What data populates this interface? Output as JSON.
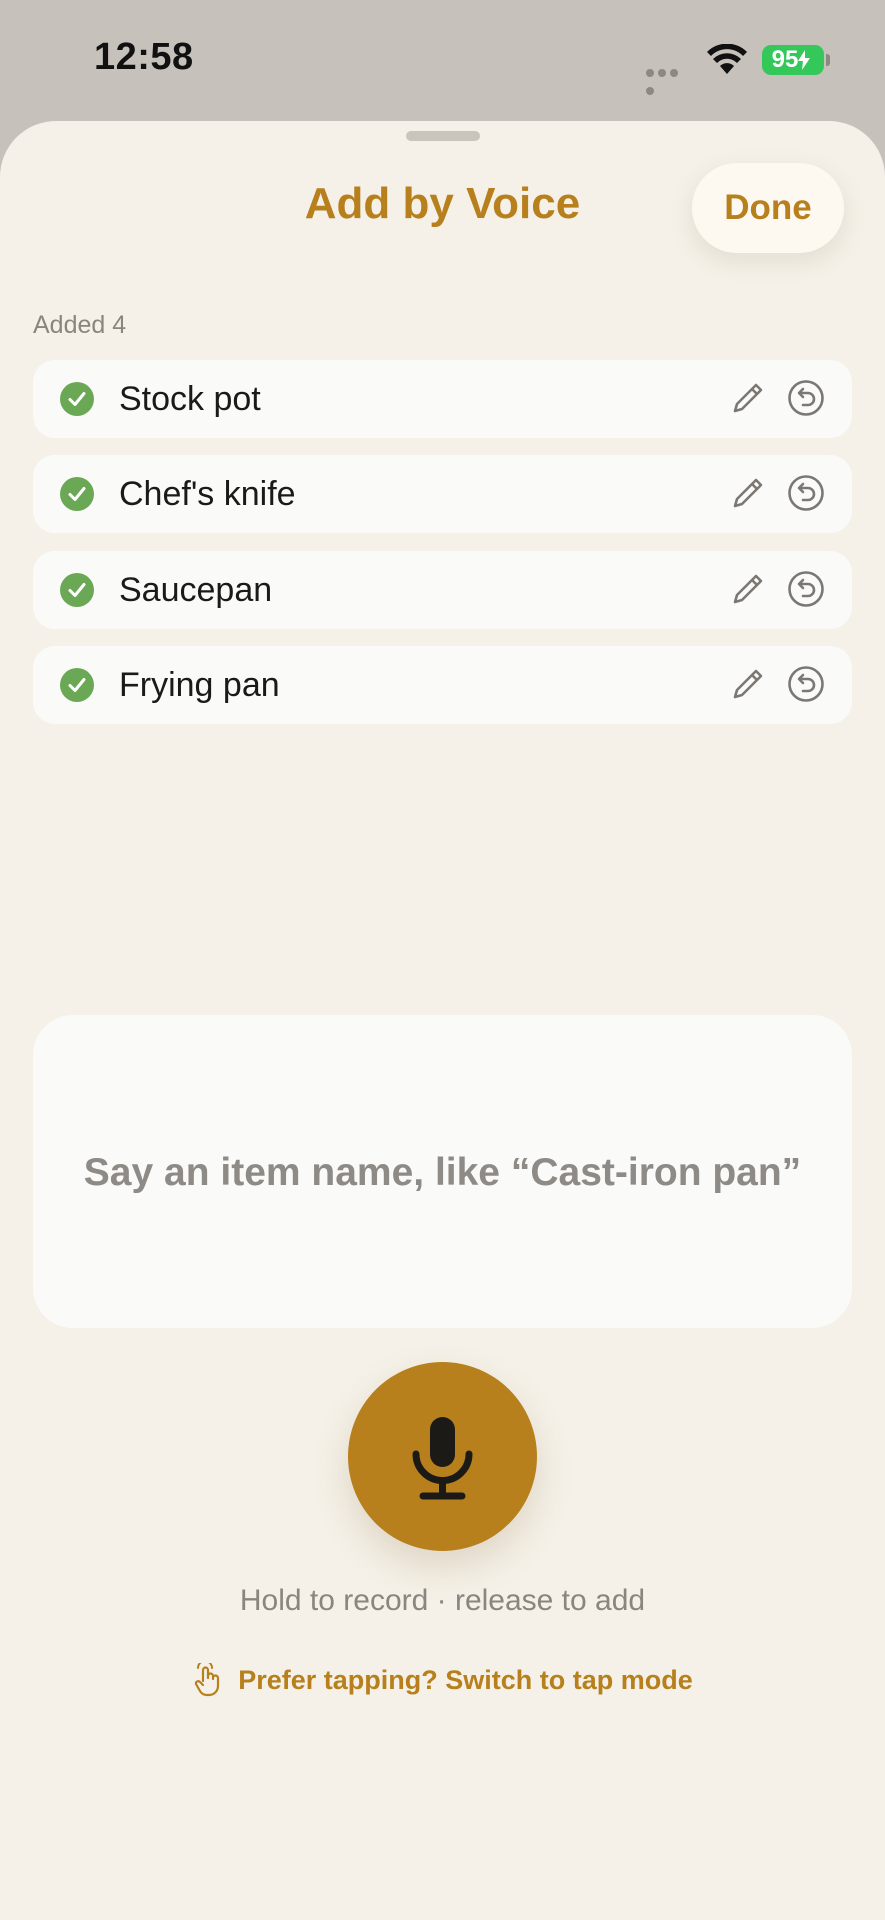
{
  "status_bar": {
    "time": "12:58",
    "battery": "95"
  },
  "sheet": {
    "title": "Add by Voice",
    "done_label": "Done"
  },
  "added": {
    "label": "Added 4",
    "items": [
      {
        "label": "Stock pot"
      },
      {
        "label": "Chef's knife"
      },
      {
        "label": "Saucepan"
      },
      {
        "label": "Frying pan"
      }
    ]
  },
  "prompt": {
    "text": "Say an item name, like “Cast-iron pan”"
  },
  "controls": {
    "hint": "Hold to record · release to add",
    "switch_label": "Prefer tapping? Switch to tap mode"
  },
  "colors": {
    "accent": "#b7801d",
    "check": "#6aa856",
    "sheet_bg": "#f5f1e8",
    "battery": "#34c759"
  },
  "icons": {
    "row_status": "check-circle-icon",
    "row_edit": "pencil-icon",
    "row_undo": "undo-icon",
    "record": "microphone-icon",
    "switch": "tap-hand-icon"
  }
}
